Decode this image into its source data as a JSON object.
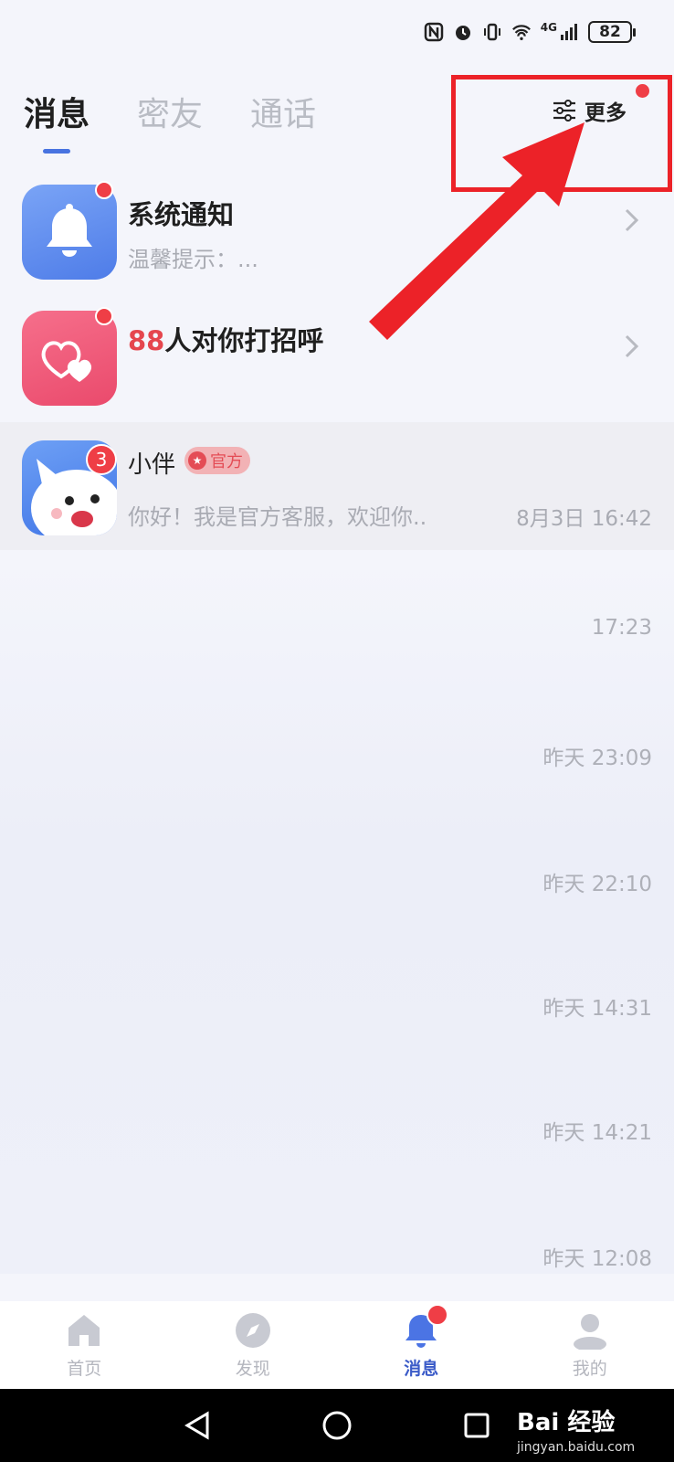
{
  "status_bar": {
    "battery": "82",
    "network": "4G"
  },
  "tabs": [
    {
      "label": "消息",
      "active": true
    },
    {
      "label": "密友",
      "active": false
    },
    {
      "label": "通话",
      "active": false
    }
  ],
  "more": {
    "label": "更多"
  },
  "system_notice": {
    "title": "系统通知",
    "subtitle": "温馨提示：..."
  },
  "greetings": {
    "count": "88",
    "title_suffix": "人对你打招呼"
  },
  "xiaoban": {
    "name": "小伴",
    "tag": "官方",
    "badge": "3",
    "message": "你好！我是官方客服，欢迎你..",
    "time": "8月3日 16:42"
  },
  "timestamps": [
    "17:23",
    "昨天 23:09",
    "昨天 22:10",
    "昨天 14:31",
    "昨天 14:21",
    "昨天 12:08"
  ],
  "bottom_nav": [
    {
      "label": "首页",
      "icon": "home-icon",
      "active": false
    },
    {
      "label": "发现",
      "icon": "compass-icon",
      "active": false
    },
    {
      "label": "消息",
      "icon": "bell-icon",
      "active": true
    },
    {
      "label": "我的",
      "icon": "user-icon",
      "active": false
    }
  ],
  "watermark": {
    "brand": "Bai 经验",
    "url": "jingyan.baidu.com"
  },
  "colors": {
    "accent": "#4873e0",
    "red": "#ef3e46",
    "highlight": "#ec2228"
  }
}
